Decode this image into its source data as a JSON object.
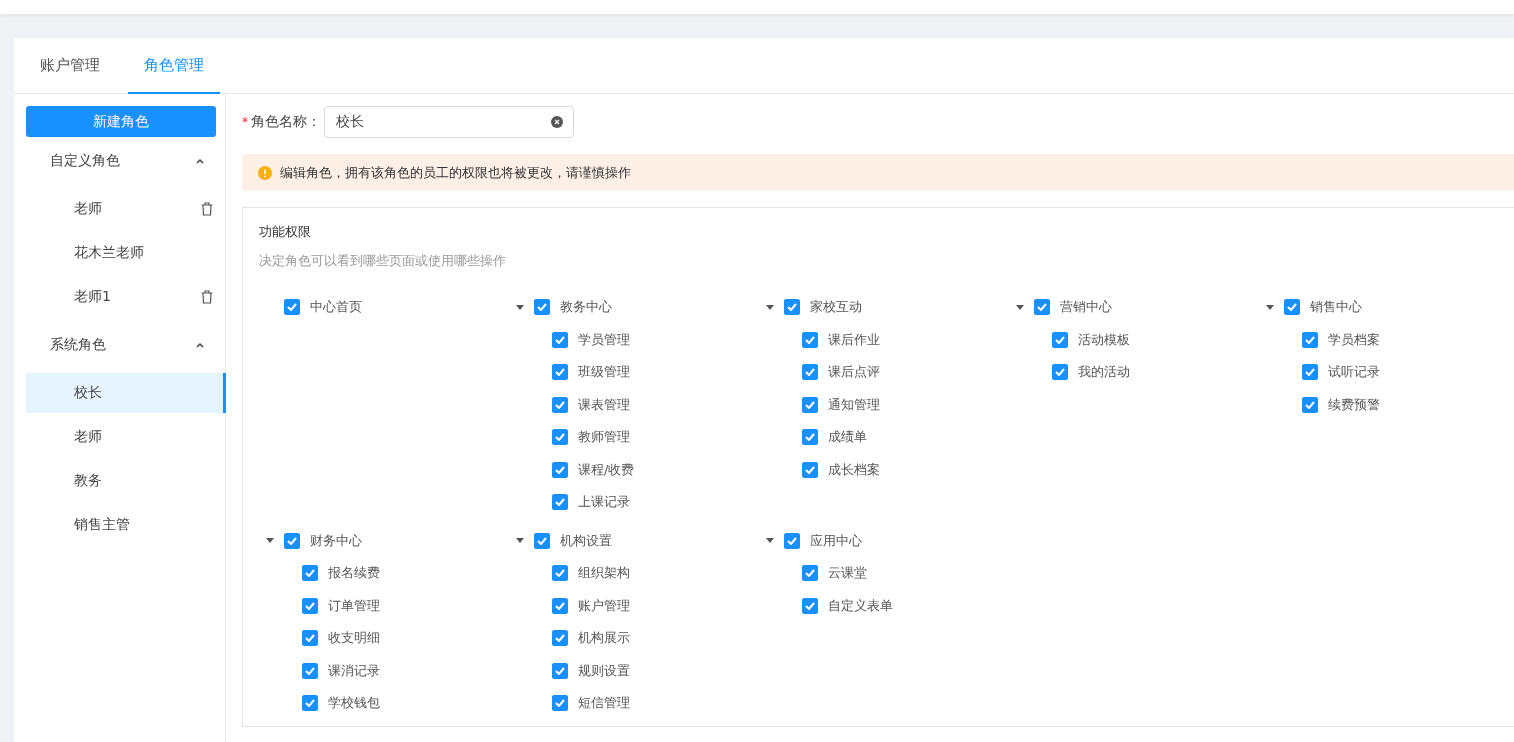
{
  "tabs": [
    {
      "label": "账户管理",
      "selected": false
    },
    {
      "label": "角色管理",
      "selected": true
    }
  ],
  "sidebar": {
    "new_button": "新建角色",
    "groups": [
      {
        "label": "自定义角色",
        "expanded": true,
        "items": [
          {
            "label": "老师",
            "selected": false,
            "deletable": true
          },
          {
            "label": "花木兰老师",
            "selected": false,
            "deletable": false
          },
          {
            "label": "老师1",
            "selected": false,
            "deletable": true
          }
        ]
      },
      {
        "label": "系统角色",
        "expanded": true,
        "items": [
          {
            "label": "校长",
            "selected": true,
            "deletable": false
          },
          {
            "label": "老师",
            "selected": false,
            "deletable": false
          },
          {
            "label": "教务",
            "selected": false,
            "deletable": false
          },
          {
            "label": "销售主管",
            "selected": false,
            "deletable": false
          }
        ]
      }
    ]
  },
  "role_name": {
    "required_mark": "*",
    "label": "角色名称：",
    "value": "校长"
  },
  "alert": {
    "text": "编辑角色，拥有该角色的员工的权限也将被更改，请谨慎操作"
  },
  "permissions": {
    "title": "功能权限",
    "subtitle": "决定角色可以看到哪些页面或使用哪些操作",
    "groups": [
      {
        "label": "中心首页",
        "checked": true
      },
      {
        "label": "教务中心",
        "checked": true,
        "expanded": true,
        "children": [
          {
            "label": "学员管理",
            "checked": true
          },
          {
            "label": "班级管理",
            "checked": true
          },
          {
            "label": "课表管理",
            "checked": true
          },
          {
            "label": "教师管理",
            "checked": true
          },
          {
            "label": "课程/收费",
            "checked": true
          },
          {
            "label": "上课记录",
            "checked": true
          }
        ]
      },
      {
        "label": "家校互动",
        "checked": true,
        "expanded": true,
        "children": [
          {
            "label": "课后作业",
            "checked": true
          },
          {
            "label": "课后点评",
            "checked": true
          },
          {
            "label": "通知管理",
            "checked": true
          },
          {
            "label": "成绩单",
            "checked": true
          },
          {
            "label": "成长档案",
            "checked": true
          }
        ]
      },
      {
        "label": "营销中心",
        "checked": true,
        "expanded": true,
        "children": [
          {
            "label": "活动模板",
            "checked": true
          },
          {
            "label": "我的活动",
            "checked": true
          }
        ]
      },
      {
        "label": "销售中心",
        "checked": true,
        "expanded": true,
        "children": [
          {
            "label": "学员档案",
            "checked": true
          },
          {
            "label": "试听记录",
            "checked": true
          },
          {
            "label": "续费预警",
            "checked": true
          }
        ]
      },
      {
        "label": "财务中心",
        "checked": true,
        "expanded": true,
        "children": [
          {
            "label": "报名续费",
            "checked": true
          },
          {
            "label": "订单管理",
            "checked": true
          },
          {
            "label": "收支明细",
            "checked": true
          },
          {
            "label": "课消记录",
            "checked": true
          },
          {
            "label": "学校钱包",
            "checked": true
          }
        ]
      },
      {
        "label": "机构设置",
        "checked": true,
        "expanded": true,
        "children": [
          {
            "label": "组织架构",
            "checked": true
          },
          {
            "label": "账户管理",
            "checked": true
          },
          {
            "label": "机构展示",
            "checked": true
          },
          {
            "label": "规则设置",
            "checked": true
          },
          {
            "label": "短信管理",
            "checked": true
          }
        ]
      },
      {
        "label": "应用中心",
        "checked": true,
        "expanded": true,
        "children": [
          {
            "label": "云课堂",
            "checked": true
          },
          {
            "label": "自定义表单",
            "checked": true
          }
        ]
      }
    ]
  }
}
